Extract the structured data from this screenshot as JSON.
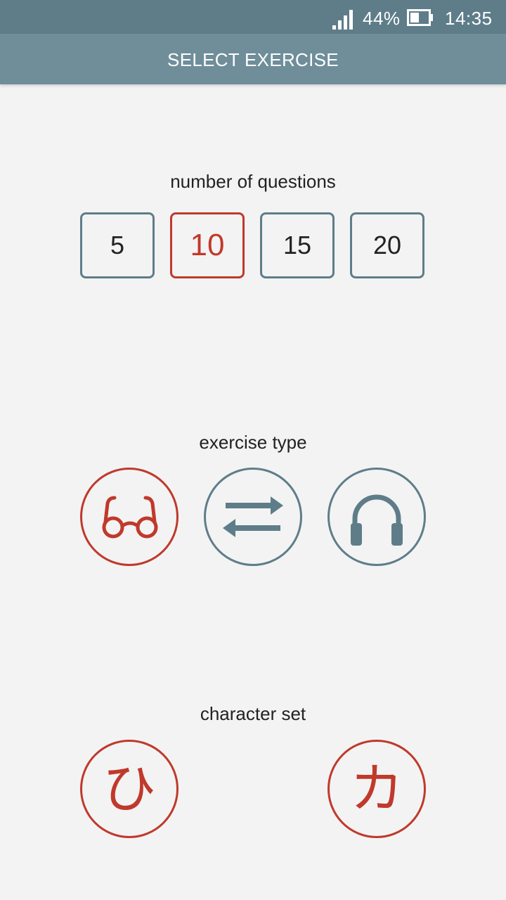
{
  "status_bar": {
    "battery_percent": "44%",
    "time": "14:35",
    "signal_icon": "signal-icon",
    "battery_icon": "battery-icon"
  },
  "app_bar": {
    "title": "SELECT EXERCISE"
  },
  "questions": {
    "label": "number of questions",
    "options": [
      "5",
      "10",
      "15",
      "20"
    ],
    "selected": "10"
  },
  "exercise_type": {
    "label": "exercise type",
    "options": [
      {
        "icon": "glasses-icon",
        "selected": true
      },
      {
        "icon": "swap-arrows-icon",
        "selected": false
      },
      {
        "icon": "headphones-icon",
        "selected": false
      }
    ]
  },
  "character_set": {
    "label": "character set",
    "options": [
      {
        "glyph": "ひ",
        "selected": true
      },
      {
        "glyph": "カ",
        "selected": true
      }
    ]
  },
  "colors": {
    "status_bar": "#5e7d89",
    "app_bar": "#6f8e9a",
    "accent_red": "#c0392b",
    "accent_slate": "#5e7d89",
    "background": "#f3f3f3"
  }
}
